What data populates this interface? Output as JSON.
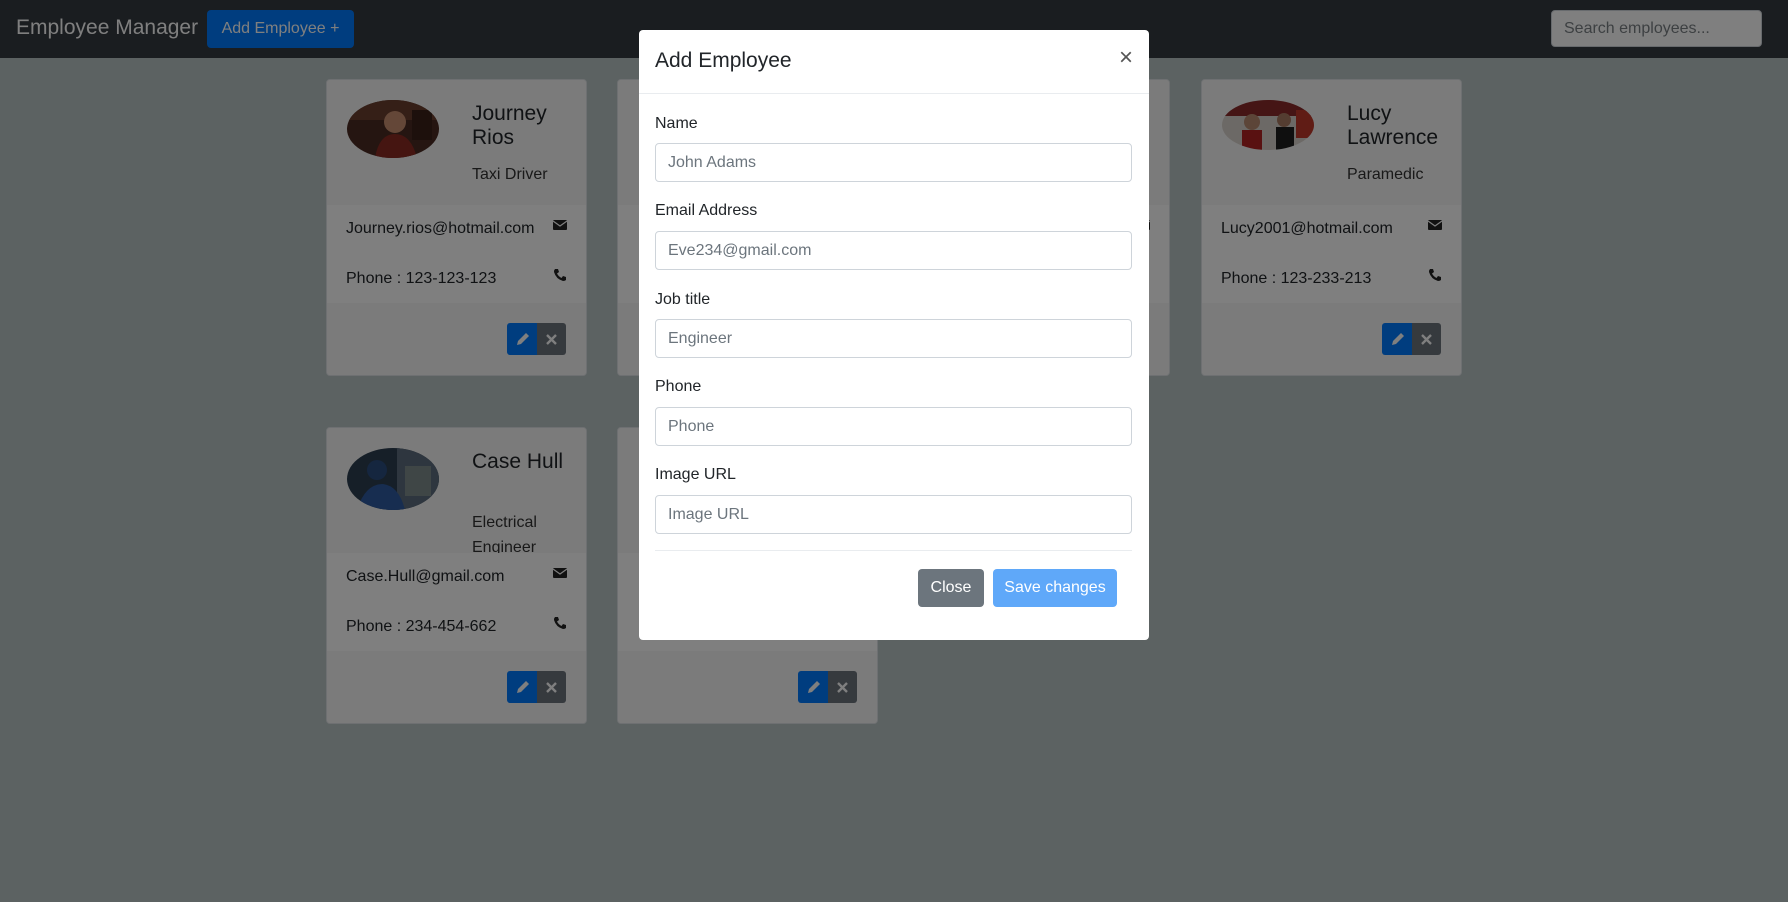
{
  "navbar": {
    "brand": "Employee Manager",
    "add_button": "Add Employee +",
    "search_placeholder": "Search employees..."
  },
  "employees": [
    {
      "name": "Journey Rios",
      "title": "Taxi Driver",
      "email": "Journey.rios@hotmail.com",
      "phone": "Phone : 123-123-123"
    },
    {
      "name": "",
      "title": "",
      "email": "",
      "phone": ""
    },
    {
      "name": "",
      "title": "",
      "email": "",
      "phone": ""
    },
    {
      "name": "Lucy Lawrence",
      "title": "Paramedic",
      "email": "Lucy2001@hotmail.com",
      "phone": "Phone : 123-233-213"
    },
    {
      "name": "Case Hull",
      "title": "Electrical Engineer",
      "email": "Case.Hull@gmail.com",
      "phone": "Phone : 234-454-662"
    },
    {
      "name": "",
      "title": "",
      "email": "",
      "phone": ""
    }
  ],
  "modal": {
    "title": "Add Employee",
    "close_icon": "×",
    "fields": [
      {
        "label": "Name",
        "placeholder": "John Adams"
      },
      {
        "label": "Email Address",
        "placeholder": "Eve234@gmail.com"
      },
      {
        "label": "Job title",
        "placeholder": "Engineer"
      },
      {
        "label": "Phone",
        "placeholder": "Phone"
      },
      {
        "label": "Image URL",
        "placeholder": "Image URL"
      }
    ],
    "close_button": "Close",
    "save_button": "Save changes"
  },
  "colors": {
    "navbar": "#343a40",
    "primary": "#007bff",
    "secondary": "#6c757d",
    "save_disabled": "#5fa8f9"
  },
  "icons": {
    "email": "envelope-icon",
    "phone": "phone-icon",
    "edit": "pencil-icon",
    "delete": "close-icon"
  }
}
